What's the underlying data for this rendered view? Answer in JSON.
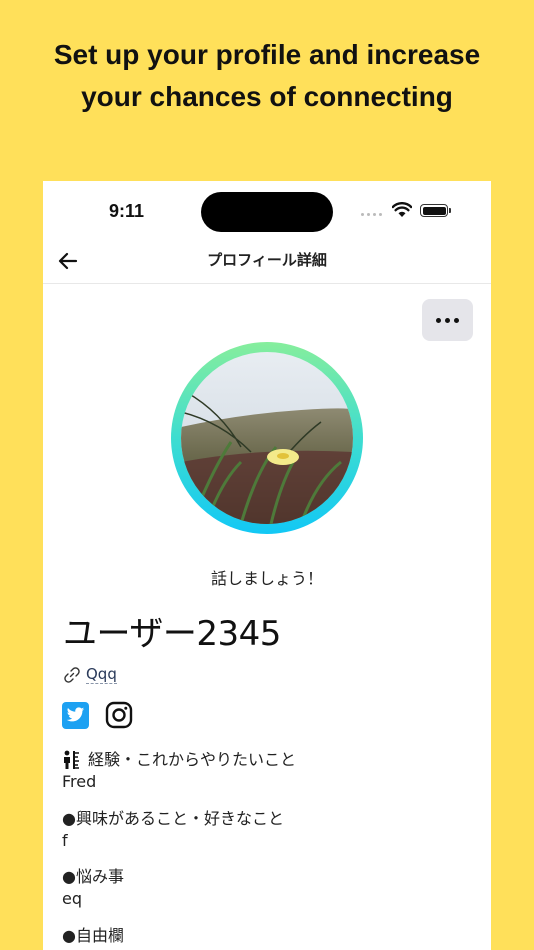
{
  "headline": {
    "line1": "Set up your profile and increase",
    "line2": "your chances of connecting"
  },
  "status_bar": {
    "time": "9:11"
  },
  "nav": {
    "title": "プロフィール詳細",
    "back_icon": "back-arrow-icon"
  },
  "profile": {
    "tagline": "話しましょう！",
    "username": "ユーザー2345",
    "link_text": "Qqq",
    "social": [
      "twitter-icon",
      "instagram-icon"
    ]
  },
  "sections": [
    {
      "title": "経験・これからやりたいこと",
      "value": "Fred"
    },
    {
      "title": "●興味があること・好きなこと",
      "value": "f"
    },
    {
      "title": "●悩み事",
      "value": "eq"
    },
    {
      "title": "●自由欄",
      "value": ""
    }
  ],
  "colors": {
    "background": "#FFE05A",
    "ring_top": "#86EE9C",
    "ring_bottom": "#12C8F5",
    "twitter": "#1DA1F2",
    "more_button_bg": "#E5E5EA"
  }
}
